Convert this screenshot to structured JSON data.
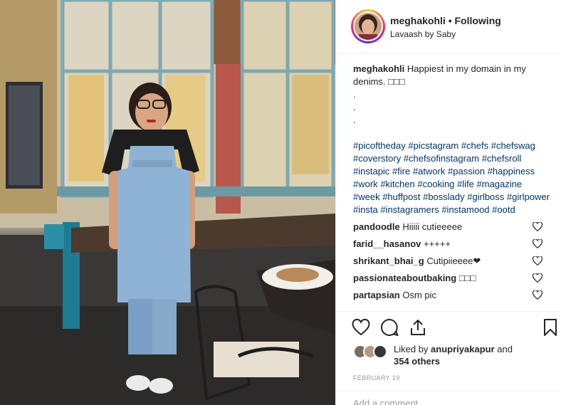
{
  "post": {
    "username": "meghakohli",
    "separator": "•",
    "follow_status": "Following",
    "location": "Lavaash by Saby"
  },
  "caption": {
    "username": "meghakohli",
    "text": "Happiest in my domain in my denims. □□□",
    "dots": [
      ".",
      ".",
      "."
    ],
    "hashtags": [
      "#picoftheday",
      "#picstagram",
      "#chefs",
      "#chefswag",
      "#coverstory",
      "#chefsofinstagram",
      "#chefsroll",
      "#instapic",
      "#fire",
      "#atwork",
      "#passion",
      "#happiness",
      "#work",
      "#kitchen",
      "#cooking",
      "#life",
      "#magazine",
      "#week",
      "#huffpost",
      "#bosslady",
      "#girlboss",
      "#girlpower",
      "#insta",
      "#instagramers",
      "#instamood",
      "#ootd"
    ]
  },
  "comments": [
    {
      "user": "pandoodle",
      "text": "Hiiiii cutieeeee"
    },
    {
      "user": "farid__hasanov",
      "text": "+++++"
    },
    {
      "user": "shrikant_bhai_g",
      "text": "Cutipiieeee❤"
    },
    {
      "user": "passionateaboutbaking",
      "text": "□□□"
    },
    {
      "user": "partapsian",
      "text": "Osm pic"
    }
  ],
  "likes": {
    "prefix": "Liked by",
    "user": "anupriyakapur",
    "connector": "and",
    "others": "354 others"
  },
  "date": "FEBRUARY 19",
  "add_comment_placeholder": "Add a comment...",
  "icons": {
    "like": "heart-outline-icon",
    "comment": "comment-bubble-icon",
    "share": "share-arrow-icon",
    "save": "bookmark-icon"
  },
  "colors": {
    "hashtag": "#003569",
    "text": "#262626",
    "muted": "#999999",
    "story_ring": [
      "#f9ce34",
      "#ee2a7b",
      "#6228d7"
    ]
  }
}
